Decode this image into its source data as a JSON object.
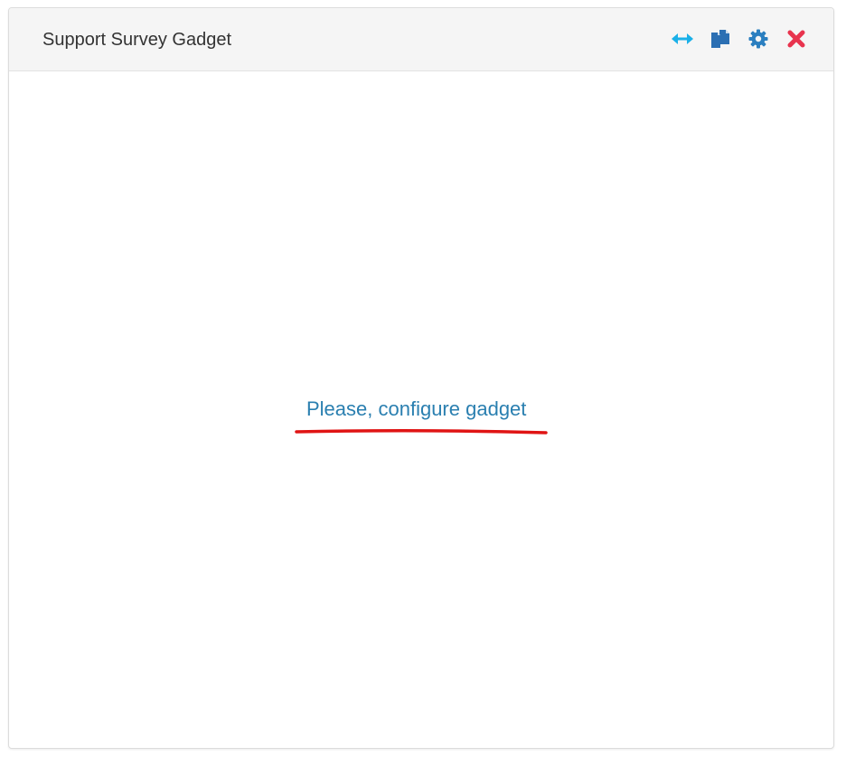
{
  "gadget": {
    "title": "Support Survey Gadget",
    "toolbar": {
      "resize_icon": "arrows-horizontal-icon",
      "copy_icon": "copy-icon",
      "settings_icon": "gear-icon",
      "close_icon": "close-icon"
    },
    "body": {
      "configure_link": "Please, configure gadget"
    }
  },
  "colors": {
    "resize_icon": "#1ab0e8",
    "copy_icon": "#2b6fb3",
    "settings_icon": "#2b7fc0",
    "close_icon": "#e8344e",
    "link": "#2a7fb0",
    "annotation_underline": "#e01414"
  }
}
